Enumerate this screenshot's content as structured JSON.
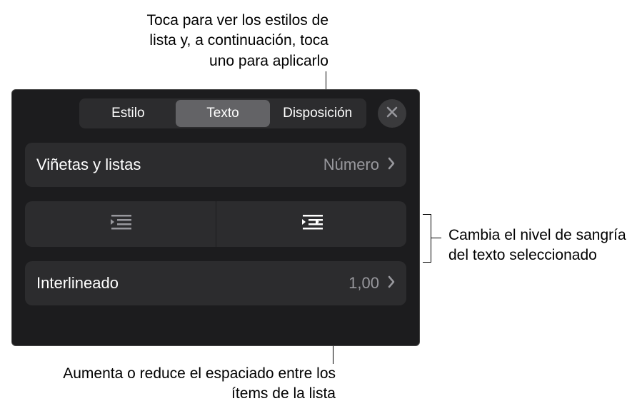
{
  "callouts": {
    "top": "Toca para ver los estilos de lista y, a continuación, toca uno para aplicarlo",
    "right": "Cambia el nivel de sangría del texto seleccionado",
    "bottom": "Aumenta o reduce el espaciado entre los ítems de la lista"
  },
  "tabs": {
    "style": "Estilo",
    "text": "Texto",
    "layout": "Disposición"
  },
  "rows": {
    "bullets_label": "Viñetas y listas",
    "bullets_value": "Número",
    "spacing_label": "Interlineado",
    "spacing_value": "1,00"
  }
}
